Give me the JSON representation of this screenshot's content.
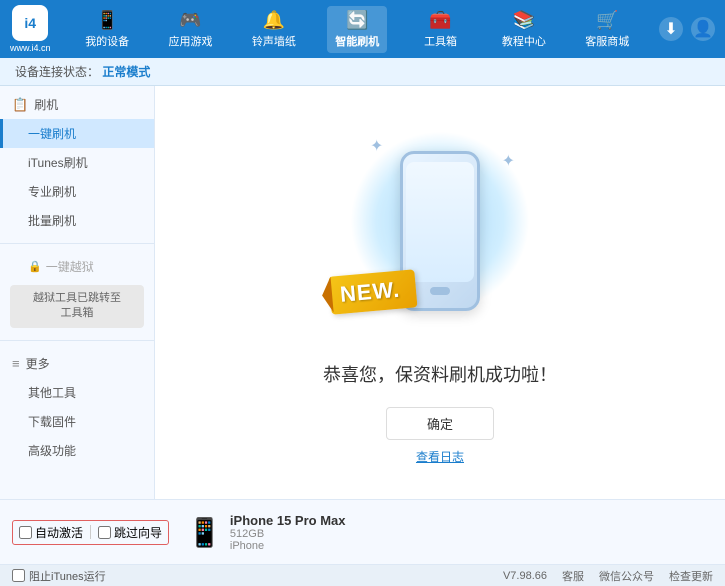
{
  "header": {
    "logo_text": "i4",
    "logo_sub": "www.i4.cn",
    "nav": [
      {
        "id": "my-device",
        "label": "我的设备",
        "icon": "📱"
      },
      {
        "id": "apps-games",
        "label": "应用游戏",
        "icon": "👤"
      },
      {
        "id": "ringtones",
        "label": "铃声墙纸",
        "icon": "🎵"
      },
      {
        "id": "smart-flash",
        "label": "智能刷机",
        "icon": "🔄",
        "active": true
      },
      {
        "id": "tools",
        "label": "工具箱",
        "icon": "💼"
      },
      {
        "id": "tutorials",
        "label": "教程中心",
        "icon": "🎓"
      },
      {
        "id": "service",
        "label": "客服商城",
        "icon": "💬"
      }
    ],
    "download_icon": "⬇",
    "user_icon": "👤"
  },
  "sub_header": {
    "prefix": "设备连接状态：",
    "mode": "正常模式"
  },
  "sidebar": {
    "sections": [
      {
        "id": "flash",
        "header": "刷机",
        "icon": "📋",
        "items": [
          {
            "id": "one-key-flash",
            "label": "一键刷机",
            "active": true
          },
          {
            "id": "itunes-flash",
            "label": "iTunes刷机"
          },
          {
            "id": "pro-flash",
            "label": "专业刷机"
          },
          {
            "id": "batch-flash",
            "label": "批量刷机"
          }
        ]
      },
      {
        "id": "one-key-jailbreak",
        "header": "一键越狱",
        "icon": "🔒",
        "disabled": true,
        "note": "越狱工具已跳转至\n工具箱"
      },
      {
        "id": "more",
        "header": "更多",
        "icon": "≡",
        "items": [
          {
            "id": "other-tools",
            "label": "其他工具"
          },
          {
            "id": "download-firmware",
            "label": "下载固件"
          },
          {
            "id": "advanced",
            "label": "高级功能"
          }
        ]
      }
    ]
  },
  "content": {
    "new_label": "NEW.",
    "success_message": "恭喜您，保资料刷机成功啦！",
    "confirm_button": "确定",
    "log_link": "查看日志"
  },
  "bottom_bar": {
    "auto_activate_label": "自动激活",
    "guide_label": "跳过向导",
    "device_name": "iPhone 15 Pro Max",
    "device_storage": "512GB",
    "device_type": "iPhone"
  },
  "status_bar": {
    "itunes_label": "阻止iTunes运行"
  },
  "footer": {
    "version": "V7.98.66",
    "items": [
      "客服",
      "微信公众号",
      "检查更新"
    ]
  }
}
